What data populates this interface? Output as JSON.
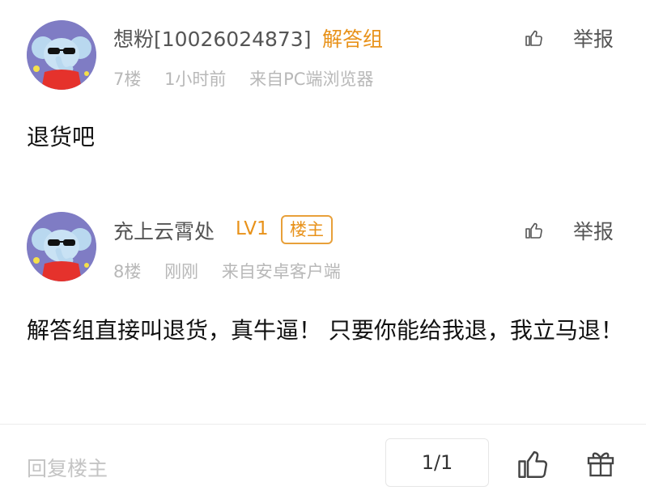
{
  "posts": [
    {
      "username": "想粉[10026024873]",
      "role": "解答组",
      "floor": "7楼",
      "time": "1小时前",
      "source": "来自PC端浏览器",
      "report_label": "举报",
      "content": "退货吧"
    },
    {
      "username": "充上云霄处",
      "level": "LV1",
      "owner_badge": "楼主",
      "floor": "8楼",
      "time": "刚刚",
      "source": "来自安卓客户端",
      "report_label": "举报",
      "content": "解答组直接叫退货，真牛逼！ 只要你能给我退，我立马退！"
    }
  ],
  "bottom_bar": {
    "reply_placeholder": "回复楼主",
    "pagination": "1/1"
  },
  "colors": {
    "accent": "#e8921a",
    "meta_text": "#b8b8b8"
  },
  "icons": [
    "thumb-up-icon",
    "gift-icon"
  ]
}
